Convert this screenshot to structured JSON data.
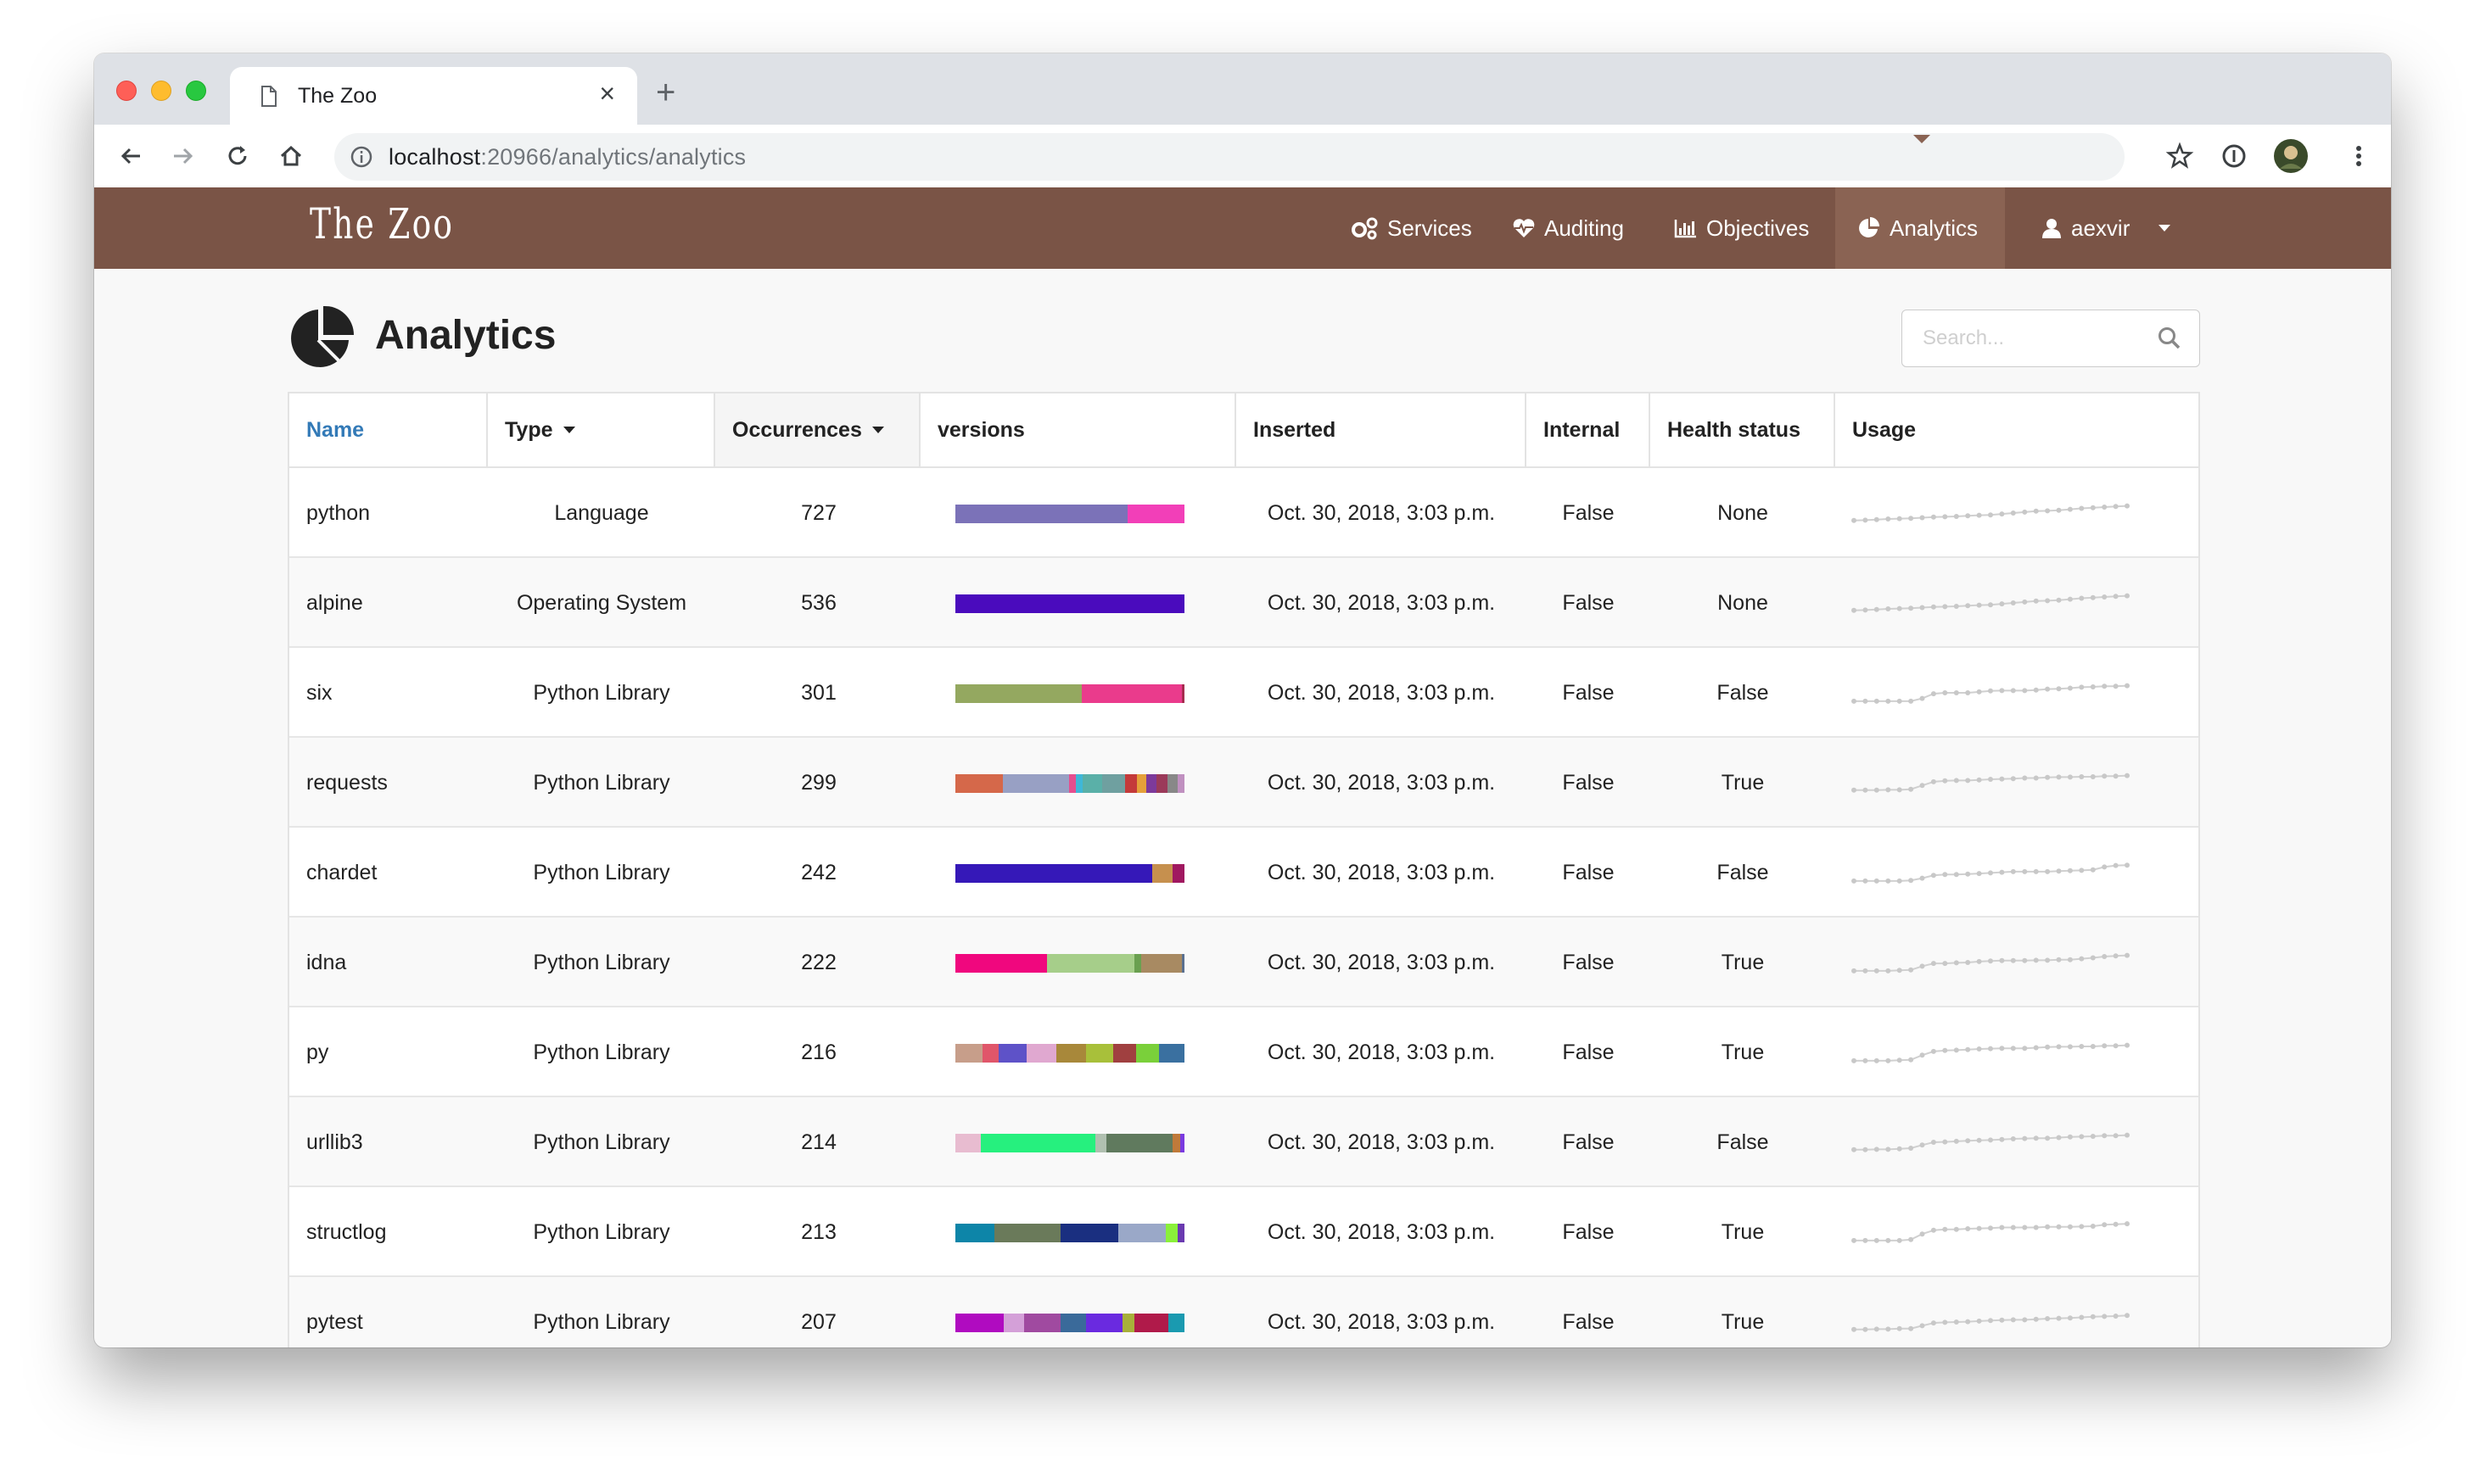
{
  "browser": {
    "tab_title": "The Zoo",
    "url_host": "localhost",
    "url_rest": ":20966/analytics/analytics"
  },
  "nav": {
    "logo": "The Zoo",
    "items": [
      {
        "label": "Services",
        "icon": "cogs-icon"
      },
      {
        "label": "Auditing",
        "icon": "heartbeat-icon"
      },
      {
        "label": "Objectives",
        "icon": "bar-chart-icon"
      },
      {
        "label": "Analytics",
        "icon": "pie-chart-icon",
        "active": true
      }
    ],
    "user": "aexvir"
  },
  "page": {
    "title": "Analytics",
    "search_placeholder": "Search..."
  },
  "table": {
    "headers": {
      "name": "Name",
      "type": "Type",
      "occurrences": "Occurrences",
      "versions": "versions",
      "inserted": "Inserted",
      "internal": "Internal",
      "health": "Health status",
      "usage": "Usage"
    },
    "rows": [
      {
        "name": "python",
        "type": "Language",
        "occurrences": "727",
        "inserted": "Oct. 30, 2018, 3:03 p.m.",
        "internal": "False",
        "health": "None",
        "versions": [
          {
            "w": 75,
            "c": "#7b72b8"
          },
          {
            "w": 25,
            "c": "#f23fb8"
          }
        ],
        "usage": [
          0.1,
          0.12,
          0.15,
          0.18,
          0.2,
          0.22,
          0.25,
          0.28,
          0.3,
          0.32,
          0.35,
          0.38,
          0.4,
          0.45,
          0.5,
          0.55,
          0.6,
          0.62,
          0.65,
          0.7,
          0.75,
          0.78,
          0.82,
          0.85,
          0.88
        ]
      },
      {
        "name": "alpine",
        "type": "Operating System",
        "occurrences": "536",
        "inserted": "Oct. 30, 2018, 3:03 p.m.",
        "internal": "False",
        "health": "None",
        "versions": [
          {
            "w": 100,
            "c": "#4a0bbd"
          }
        ],
        "usage": [
          0.1,
          0.12,
          0.15,
          0.18,
          0.2,
          0.22,
          0.25,
          0.28,
          0.3,
          0.32,
          0.35,
          0.38,
          0.4,
          0.45,
          0.5,
          0.55,
          0.6,
          0.62,
          0.65,
          0.7,
          0.75,
          0.78,
          0.82,
          0.85,
          0.88
        ]
      },
      {
        "name": "six",
        "type": "Python Library",
        "occurrences": "301",
        "inserted": "Oct. 30, 2018, 3:03 p.m.",
        "internal": "False",
        "health": "False",
        "versions": [
          {
            "w": 55,
            "c": "#94a860"
          },
          {
            "w": 44,
            "c": "#ea3b8c"
          },
          {
            "w": 1,
            "c": "#a72c4f"
          }
        ],
        "usage": [
          0.05,
          0.05,
          0.05,
          0.05,
          0.05,
          0.05,
          0.2,
          0.45,
          0.5,
          0.5,
          0.5,
          0.55,
          0.6,
          0.62,
          0.62,
          0.62,
          0.65,
          0.7,
          0.72,
          0.75,
          0.8,
          0.82,
          0.85,
          0.85,
          0.88
        ]
      },
      {
        "name": "requests",
        "type": "Python Library",
        "occurrences": "299",
        "inserted": "Oct. 30, 2018, 3:03 p.m.",
        "internal": "False",
        "health": "True",
        "versions": [
          {
            "w": 20,
            "c": "#d5684a"
          },
          {
            "w": 28,
            "c": "#98a0c4"
          },
          {
            "w": 3,
            "c": "#e54e8f"
          },
          {
            "w": 3,
            "c": "#3fb7d8"
          },
          {
            "w": 8,
            "c": "#5ab0a8"
          },
          {
            "w": 10,
            "c": "#6fa0a0"
          },
          {
            "w": 5,
            "c": "#c43a3a"
          },
          {
            "w": 4,
            "c": "#e5a03a"
          },
          {
            "w": 4,
            "c": "#7d3a9b"
          },
          {
            "w": 5,
            "c": "#9b3a5a"
          },
          {
            "w": 4,
            "c": "#888888"
          },
          {
            "w": 3,
            "c": "#c090c0"
          }
        ],
        "usage": [
          0.1,
          0.1,
          0.1,
          0.12,
          0.12,
          0.15,
          0.35,
          0.55,
          0.6,
          0.62,
          0.62,
          0.65,
          0.68,
          0.7,
          0.72,
          0.75,
          0.75,
          0.78,
          0.8,
          0.8,
          0.82,
          0.82,
          0.85,
          0.85,
          0.88
        ]
      },
      {
        "name": "chardet",
        "type": "Python Library",
        "occurrences": "242",
        "inserted": "Oct. 30, 2018, 3:03 p.m.",
        "internal": "False",
        "health": "False",
        "versions": [
          {
            "w": 86,
            "c": "#3518b8"
          },
          {
            "w": 9,
            "c": "#c6904e"
          },
          {
            "w": 5,
            "c": "#a01860"
          }
        ],
        "usage": [
          0.05,
          0.05,
          0.05,
          0.05,
          0.05,
          0.08,
          0.2,
          0.35,
          0.4,
          0.4,
          0.42,
          0.45,
          0.48,
          0.52,
          0.55,
          0.55,
          0.55,
          0.55,
          0.58,
          0.6,
          0.62,
          0.65,
          0.8,
          0.88,
          0.9
        ]
      },
      {
        "name": "idna",
        "type": "Python Library",
        "occurrences": "222",
        "inserted": "Oct. 30, 2018, 3:03 p.m.",
        "internal": "False",
        "health": "True",
        "versions": [
          {
            "w": 40,
            "c": "#f0077e"
          },
          {
            "w": 38,
            "c": "#a6ce8a"
          },
          {
            "w": 3,
            "c": "#6aa050"
          },
          {
            "w": 18,
            "c": "#a88a62"
          },
          {
            "w": 1,
            "c": "#5a7090"
          }
        ],
        "usage": [
          0.05,
          0.05,
          0.05,
          0.05,
          0.08,
          0.1,
          0.3,
          0.45,
          0.45,
          0.48,
          0.5,
          0.55,
          0.58,
          0.6,
          0.6,
          0.6,
          0.62,
          0.62,
          0.65,
          0.65,
          0.7,
          0.75,
          0.82,
          0.85,
          0.88
        ]
      },
      {
        "name": "py",
        "type": "Python Library",
        "occurrences": "216",
        "inserted": "Oct. 30, 2018, 3:03 p.m.",
        "internal": "False",
        "health": "True",
        "versions": [
          {
            "w": 12,
            "c": "#c79e8a"
          },
          {
            "w": 7,
            "c": "#e0566a"
          },
          {
            "w": 12,
            "c": "#5e52c8"
          },
          {
            "w": 13,
            "c": "#e0a8d0"
          },
          {
            "w": 13,
            "c": "#a8883a"
          },
          {
            "w": 12,
            "c": "#a8c03a"
          },
          {
            "w": 10,
            "c": "#a04040"
          },
          {
            "w": 10,
            "c": "#7ad03a"
          },
          {
            "w": 11,
            "c": "#3a70a0"
          }
        ],
        "usage": [
          0.05,
          0.05,
          0.05,
          0.05,
          0.08,
          0.1,
          0.35,
          0.55,
          0.6,
          0.62,
          0.65,
          0.68,
          0.7,
          0.72,
          0.72,
          0.72,
          0.75,
          0.78,
          0.8,
          0.8,
          0.82,
          0.82,
          0.85,
          0.85,
          0.88
        ]
      },
      {
        "name": "urllib3",
        "type": "Python Library",
        "occurrences": "214",
        "inserted": "Oct. 30, 2018, 3:03 p.m.",
        "internal": "False",
        "health": "False",
        "versions": [
          {
            "w": 11,
            "c": "#e8bcd0"
          },
          {
            "w": 50,
            "c": "#26f07e"
          },
          {
            "w": 5,
            "c": "#b0c0b0"
          },
          {
            "w": 29,
            "c": "#607a5e"
          },
          {
            "w": 3,
            "c": "#c07a3a"
          },
          {
            "w": 2,
            "c": "#7a3ae0"
          }
        ],
        "usage": [
          0.1,
          0.1,
          0.12,
          0.12,
          0.15,
          0.18,
          0.35,
          0.5,
          0.52,
          0.55,
          0.58,
          0.6,
          0.62,
          0.65,
          0.68,
          0.7,
          0.72,
          0.72,
          0.75,
          0.78,
          0.8,
          0.82,
          0.85,
          0.85,
          0.88
        ]
      },
      {
        "name": "structlog",
        "type": "Python Library",
        "occurrences": "213",
        "inserted": "Oct. 30, 2018, 3:03 p.m.",
        "internal": "False",
        "health": "True",
        "versions": [
          {
            "w": 17,
            "c": "#0d85a8"
          },
          {
            "w": 29,
            "c": "#6a7a5a"
          },
          {
            "w": 25,
            "c": "#1a2f80"
          },
          {
            "w": 21,
            "c": "#9aa8c8"
          },
          {
            "w": 5,
            "c": "#8af03a"
          },
          {
            "w": 3,
            "c": "#6a3ab0"
          }
        ],
        "usage": [
          0.05,
          0.05,
          0.05,
          0.05,
          0.05,
          0.1,
          0.4,
          0.6,
          0.65,
          0.65,
          0.68,
          0.7,
          0.72,
          0.75,
          0.75,
          0.75,
          0.75,
          0.78,
          0.78,
          0.78,
          0.8,
          0.82,
          0.9,
          0.92,
          0.95
        ]
      },
      {
        "name": "pytest",
        "type": "Python Library",
        "occurrences": "207",
        "inserted": "Oct. 30, 2018, 3:03 p.m.",
        "internal": "False",
        "health": "True",
        "versions": [
          {
            "w": 21,
            "c": "#b00bc0"
          },
          {
            "w": 9,
            "c": "#d4a0d8"
          },
          {
            "w": 16,
            "c": "#a04aa0"
          },
          {
            "w": 11,
            "c": "#3a6a9a"
          },
          {
            "w": 16,
            "c": "#6a2ae0"
          },
          {
            "w": 5,
            "c": "#a8b03a"
          },
          {
            "w": 15,
            "c": "#b01a4a"
          },
          {
            "w": 7,
            "c": "#1a9ab0"
          }
        ],
        "usage": [
          0.1,
          0.1,
          0.12,
          0.12,
          0.15,
          0.15,
          0.3,
          0.45,
          0.48,
          0.5,
          0.52,
          0.55,
          0.58,
          0.6,
          0.62,
          0.62,
          0.65,
          0.68,
          0.7,
          0.72,
          0.75,
          0.78,
          0.8,
          0.82,
          0.85
        ]
      }
    ]
  }
}
